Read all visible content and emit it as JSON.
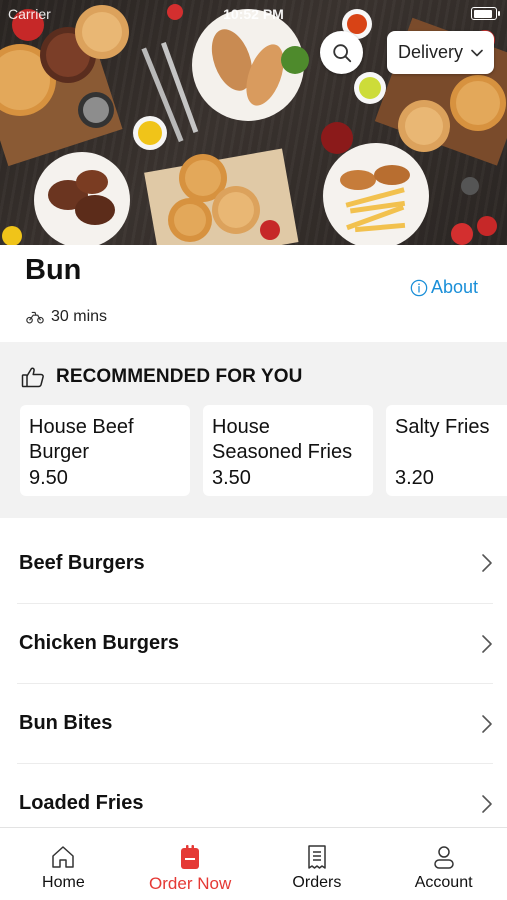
{
  "status_bar": {
    "carrier": "Carrier",
    "time": "10:52 PM"
  },
  "header": {
    "delivery_label": "Delivery",
    "search_icon": "search-icon"
  },
  "store": {
    "name": "Bun",
    "about_label": "About",
    "eta": "30 mins"
  },
  "recommended": {
    "title": "RECOMMENDED FOR YOU",
    "items": [
      {
        "name": "House Beef Burger",
        "price": "9.50"
      },
      {
        "name": "House Seasoned Fries",
        "price": "3.50"
      },
      {
        "name": "Salty Fries",
        "price": "3.20"
      }
    ]
  },
  "categories": [
    {
      "label": "Beef Burgers"
    },
    {
      "label": "Chicken Burgers"
    },
    {
      "label": "Bun Bites"
    },
    {
      "label": "Loaded Fries"
    }
  ],
  "tabs": [
    {
      "label": "Home",
      "icon": "home-icon",
      "active": false
    },
    {
      "label": "Order Now",
      "icon": "order-bag-icon",
      "active": true
    },
    {
      "label": "Orders",
      "icon": "receipt-icon",
      "active": false
    },
    {
      "label": "Account",
      "icon": "person-icon",
      "active": false
    }
  ],
  "colors": {
    "accent": "#e53935",
    "link": "#1a8fd8",
    "section_bg": "#f2f2f2"
  }
}
